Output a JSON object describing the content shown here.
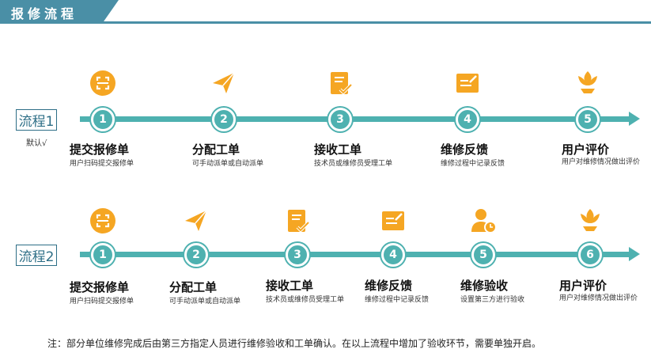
{
  "header": {
    "title": "报修流程"
  },
  "flows": [
    {
      "label": "流程1",
      "note": "默认√",
      "steps": [
        {
          "num": "1",
          "title": "提交报修单",
          "desc": "用户扫码提交报修单",
          "icon": "scan-icon"
        },
        {
          "num": "2",
          "title": "分配工单",
          "desc": "可手动派单或自动派单",
          "icon": "paper-plane-icon"
        },
        {
          "num": "3",
          "title": "接收工单",
          "desc": "技术员或维修员受理工单",
          "icon": "checklist-icon"
        },
        {
          "num": "4",
          "title": "维修反馈",
          "desc": "维修过程中记录反馈",
          "icon": "edit-note-icon"
        },
        {
          "num": "5",
          "title": "用户评价",
          "desc": "用户对维修情况做出评价",
          "icon": "flower-icon"
        }
      ]
    },
    {
      "label": "流程2",
      "note": "",
      "steps": [
        {
          "num": "1",
          "title": "提交报修单",
          "desc": "用户扫码提交报修单",
          "icon": "scan-icon"
        },
        {
          "num": "2",
          "title": "分配工单",
          "desc": "可手动派单或自动派单",
          "icon": "paper-plane-icon"
        },
        {
          "num": "3",
          "title": "接收工单",
          "desc": "技术员或维修员受理工单",
          "icon": "checklist-icon"
        },
        {
          "num": "4",
          "title": "维修反馈",
          "desc": "维修过程中记录反馈",
          "icon": "edit-note-icon"
        },
        {
          "num": "5",
          "title": "维修验收",
          "desc": "设置第三方进行验收",
          "icon": "user-clock-icon"
        },
        {
          "num": "6",
          "title": "用户评价",
          "desc": "用户对维修情况做出评价",
          "icon": "flower-icon"
        }
      ]
    }
  ],
  "footnote": "注：部分单位维修完成后由第三方指定人员进行维修验收和工单确认。在以上流程中增加了验收环节，需要单独开启。",
  "colors": {
    "accent": "#4eb1b0",
    "header": "#4a8fa6",
    "icon": "#f5a623"
  }
}
